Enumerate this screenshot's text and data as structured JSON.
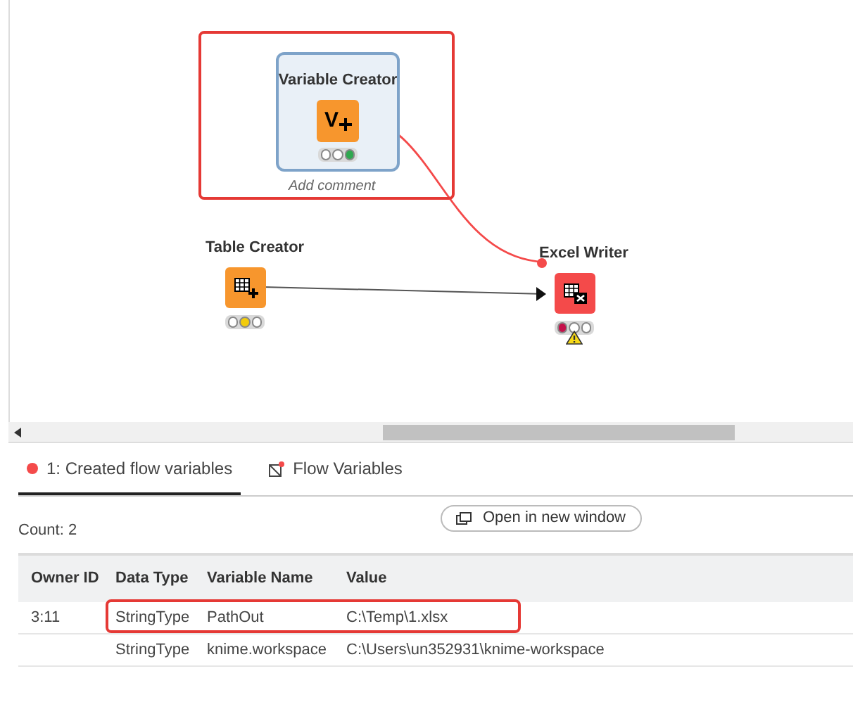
{
  "canvas": {
    "nodes": [
      {
        "title": "Variable Creator",
        "kind": "variable",
        "icon_label": "V",
        "lights": [
          {
            "color": "#ffffff"
          },
          {
            "color": "#ffffff"
          },
          {
            "color": "#2fa84f"
          }
        ],
        "comment": "Add comment"
      },
      {
        "title": "Table Creator",
        "kind": "table-source",
        "lights": [
          {
            "color": "#ffffff"
          },
          {
            "color": "#f2cc0c"
          },
          {
            "color": "#ffffff"
          }
        ]
      },
      {
        "title": "Excel Writer",
        "kind": "excel-sink",
        "lights": [
          {
            "color": "#c4114b"
          },
          {
            "color": "#ffffff"
          },
          {
            "color": "#ffffff"
          }
        ],
        "warning": true
      }
    ]
  },
  "panel": {
    "tabs": [
      {
        "label": "1: Created flow variables",
        "kind": "port",
        "selected": true
      },
      {
        "label": "Flow Variables",
        "kind": "variables",
        "selected": false
      }
    ],
    "count": "Count: 2",
    "open_button": "Open in new window",
    "table": {
      "columns": [
        "Owner ID",
        "Data Type",
        "Variable Name",
        "Value"
      ],
      "rows": [
        {
          "cells": [
            "3:11",
            "StringType",
            "PathOut",
            "C:\\Temp\\1.xlsx"
          ],
          "highlighted": true
        },
        {
          "cells": [
            "",
            "StringType",
            "knime.workspace",
            "C:\\Users\\un352931\\knime-workspace"
          ],
          "highlighted": false
        }
      ]
    }
  }
}
